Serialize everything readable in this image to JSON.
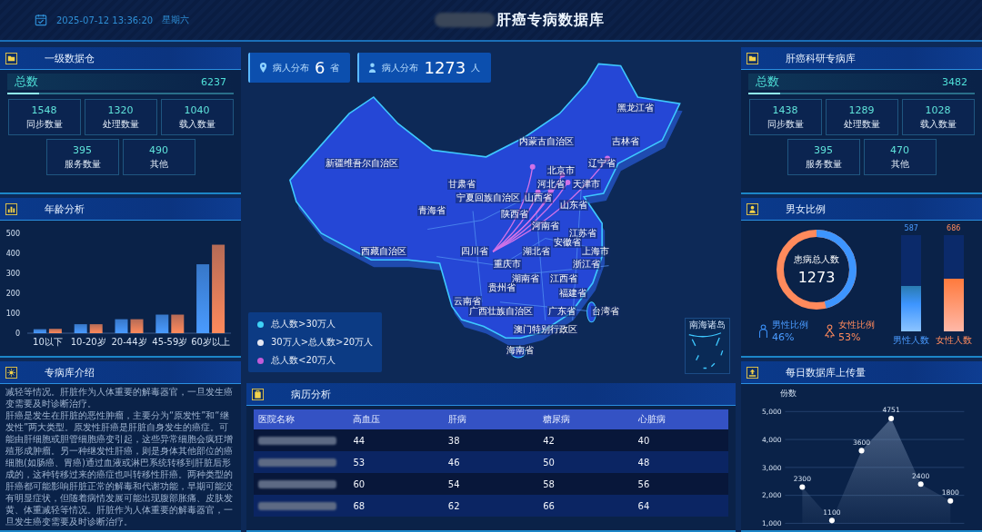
{
  "header": {
    "date": "2025-07-12 13:36:20",
    "weekday": "星期六",
    "title": "肝癌专病数据库"
  },
  "warehouse": {
    "title": "一级数据仓",
    "total_label": "总数",
    "total": "6237",
    "level": 0.14,
    "stats": [
      {
        "value": "1548",
        "label": "同步数量"
      },
      {
        "value": "1320",
        "label": "处理数量"
      },
      {
        "value": "1040",
        "label": "载入数量"
      },
      {
        "value": "395",
        "label": "服务数量"
      },
      {
        "value": "490",
        "label": "其他"
      }
    ]
  },
  "age": {
    "title": "年龄分析",
    "chart_data": {
      "type": "bar",
      "categories": [
        "10以下",
        "10-20岁",
        "20-44岁",
        "45-59岁",
        "60岁以上"
      ],
      "series": [
        {
          "color": "#4a9bff",
          "values": [
            20,
            45,
            70,
            93,
            345
          ]
        },
        {
          "color": "#ff8a5c",
          "values": [
            22,
            45,
            70,
            93,
            443
          ]
        }
      ],
      "ylim": [
        0,
        500
      ],
      "yticks": [
        0,
        100,
        200,
        300,
        400,
        500
      ]
    }
  },
  "intro": {
    "title": "专病库介绍",
    "paragraphs": [
      "减轻等情况。肝脏作为人体重要的解毒器官，一旦发生癌变需要及时诊断治疗。",
      "肝癌是发生在肝脏的恶性肿瘤，主要分为“原发性”和“继发性”两大类型。原发性肝癌是肝脏自身发生的癌症。可能由肝细胞或胆管细胞癌变引起，这些异常细胞会疯狂增殖形成肿瘤。另一种继发性肝癌，则是身体其他部位的癌细胞(如肠癌、胃癌)通过血液或淋巴系统转移到肝脏后形成的，这种转移过来的癌症也叫转移性肝癌。两种类型的肝癌都可能影响肝脏正常的解毒和代谢功能，早期可能没有明显症状，但随着病情发展可能出现腹部胀痛、皮肤发黄、体重减轻等情况。肝脏作为人体重要的解毒器官，一旦发生癌变需要及时诊断治疗。"
    ]
  },
  "map": {
    "cards": [
      {
        "label": "病人分布",
        "value": "6",
        "unit": "省"
      },
      {
        "label": "病人分布",
        "value": "1273",
        "unit": "人"
      }
    ],
    "provinces": [
      "黑龙江省",
      "内蒙古自治区",
      "吉林省",
      "新疆维吾尔自治区",
      "辽宁省",
      "北京市",
      "甘肃省",
      "河北省",
      "天津市",
      "宁夏回族自治区",
      "山西省",
      "山东省",
      "青海省",
      "陕西省",
      "河南省",
      "江苏省",
      "安徽省",
      "西藏自治区",
      "四川省",
      "湖北省",
      "上海市",
      "重庆市",
      "浙江省",
      "湖南省",
      "江西省",
      "贵州省",
      "福建省",
      "云南省",
      "广西壮族自治区",
      "广东省",
      "台湾省",
      "澳门特别行政区",
      "海南省"
    ],
    "inset_title": "南海诸岛",
    "legend": [
      {
        "label": "总人数>30万人",
        "color": "#3fd2f7"
      },
      {
        "label": "30万人>总人数>20万人",
        "color": "#e6e8f2"
      },
      {
        "label": "总人数<20万人",
        "color": "#c25cd8"
      }
    ]
  },
  "records": {
    "title": "病历分析",
    "columns": [
      "医院名称",
      "高血压",
      "肝病",
      "糖尿病",
      "心脏病"
    ],
    "rows": [
      {
        "cells": [
          "",
          "44",
          "38",
          "42",
          "40"
        ]
      },
      {
        "cells": [
          "",
          "53",
          "46",
          "50",
          "48"
        ]
      },
      {
        "cells": [
          "",
          "60",
          "54",
          "58",
          "56"
        ]
      },
      {
        "cells": [
          "",
          "68",
          "62",
          "66",
          "64"
        ]
      }
    ]
  },
  "research": {
    "title": "肝癌科研专病库",
    "total_label": "总数",
    "total": "3482",
    "level": 0.14,
    "stats": [
      {
        "value": "1438",
        "label": "同步数量"
      },
      {
        "value": "1289",
        "label": "处理数量"
      },
      {
        "value": "1028",
        "label": "载入数量"
      },
      {
        "value": "395",
        "label": "服务数量"
      },
      {
        "value": "470",
        "label": "其他"
      }
    ]
  },
  "gender": {
    "title": "男女比例",
    "total_label": "患病总人数",
    "total": "1273",
    "male": {
      "ratio_label": "男性比例",
      "percent": "46%",
      "count": "587",
      "bar_label": "男性人数",
      "level": 0.47
    },
    "female": {
      "ratio_label": "女性比例",
      "percent": "53%",
      "count": "686",
      "bar_label": "女性人数",
      "level": 0.55
    }
  },
  "uploads": {
    "title": "每日数据库上传量",
    "chart_data": {
      "type": "area",
      "ylabel": "份数",
      "values": [
        2300,
        1100,
        3600,
        4751,
        2400,
        1800
      ],
      "grid": true,
      "ylim": [
        1000,
        5000
      ],
      "yticks": [
        {
          "value": 1000,
          "label": "1,000"
        },
        {
          "value": 2000,
          "label": "2,000"
        },
        {
          "value": 3000,
          "label": "3,000"
        },
        {
          "value": 4000,
          "label": "4,000"
        },
        {
          "value": 5000,
          "label": "5,000"
        }
      ],
      "data_labels": true
    }
  }
}
